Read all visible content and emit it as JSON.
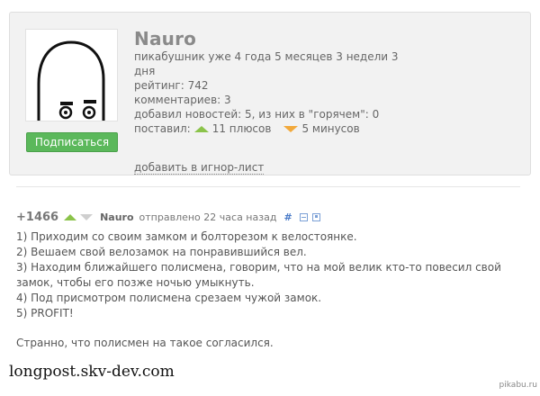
{
  "profile": {
    "username": "Nauro",
    "tenure": "пикабушник уже 4 года 5 месяцев 3 недели 3 дня",
    "rating": "рейтинг: 742",
    "comments": "комментариев: 3",
    "news": "добавил новостей: 5, из них в \"горячем\": 0",
    "voted_label": "поставил:",
    "pluses": "11 плюсов",
    "minuses": "5 минусов",
    "subscribe_label": "Подписаться",
    "ignore_label": "добавить в игнор-лист"
  },
  "post": {
    "rating": "+1466",
    "author": "Nauro",
    "posted": "отправлено 22 часа назад",
    "hash": "#",
    "lines": [
      "1) Приходим со своим замком и болторезом к велостоянке.",
      "2) Вешаем свой велозамок на понравившийся вел.",
      "3) Находим ближайшего полисмена, говорим, что на мой велик кто-то повесил свой замок, чтобы его позже ночью умыкнуть.",
      "4) Под присмотром полисмена срезаем чужой замок.",
      "5) PROFIT!"
    ],
    "closing": "Странно, что полисмен на такое согласился."
  },
  "footer": {
    "source": "longpost.skv-dev.com",
    "site": "pikabu.ru"
  },
  "colors": {
    "subscribe": "#5bb85b",
    "upvote": "#8bc34a",
    "downvote": "#f2a93b",
    "link": "#4a7bc8"
  }
}
